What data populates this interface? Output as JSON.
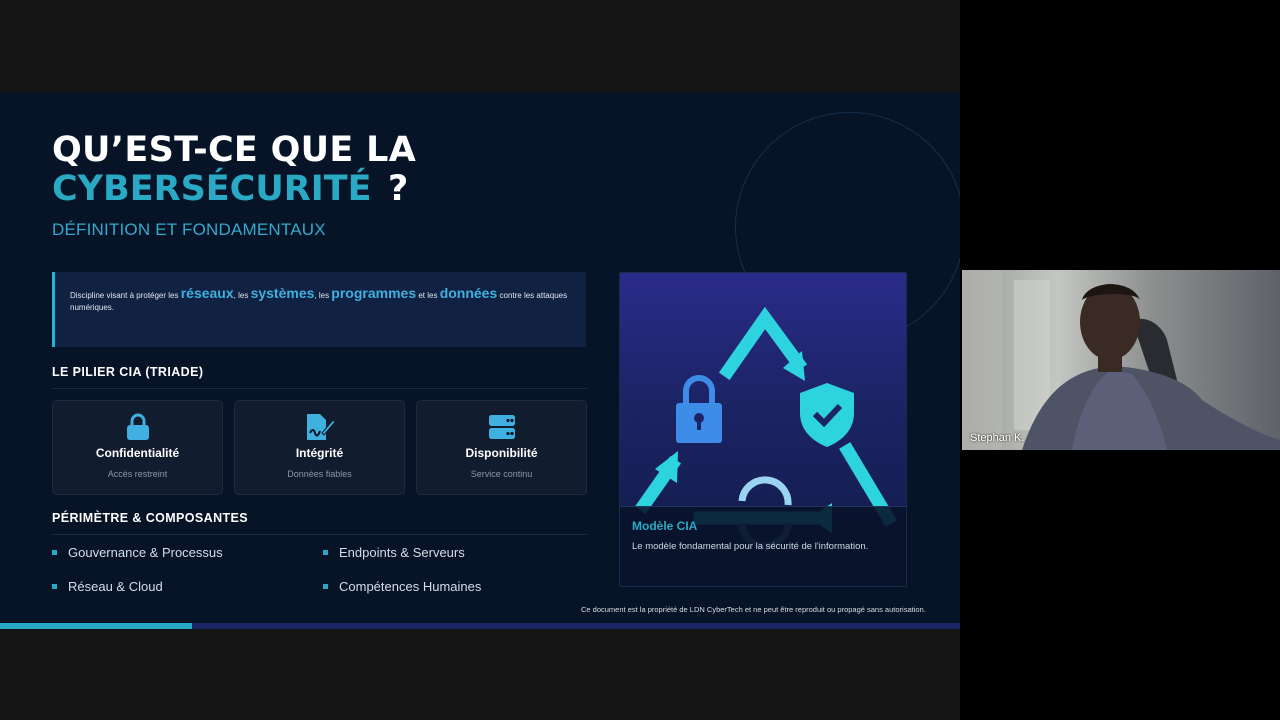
{
  "slide": {
    "title_line1": "QU’EST-CE QUE LA",
    "title_line2": "CYBERSÉCURITÉ",
    "title_q": "?",
    "subtitle": "DÉFINITION ET FONDAMENTAUX",
    "definition": {
      "p1": "Discipline visant à protéger les ",
      "k1": "réseaux",
      "p2": ", les ",
      "k2": "systèmes",
      "p3": ", les ",
      "k3": "programmes",
      "p4": " et les ",
      "k4": "données",
      "p5": " contre les attaques numériques."
    },
    "pillar_title": "LE PILIER CIA (TRIADE)",
    "cards": [
      {
        "title": "Confidentialité",
        "desc": "Accès restreint",
        "icon": "lock-icon"
      },
      {
        "title": "Intégrité",
        "desc": "Données fiables",
        "icon": "signed-document-icon"
      },
      {
        "title": "Disponibilité",
        "desc": "Service continu",
        "icon": "server-icon"
      }
    ],
    "scope_title": "PÉRIMÈTRE & COMPOSANTES",
    "bullets": [
      "Gouvernance & Processus",
      "Endpoints & Serveurs",
      "Réseau & Cloud",
      "Compétences Humaines"
    ],
    "cia_panel": {
      "caption_title": "Modèle CIA",
      "caption_text": "Le modèle fondamental pour la sécurité de l'information."
    },
    "notice": "Ce document est la propriété de LDN CyberTech et ne peut être reproduit ou propagé sans autorisation.",
    "progress": 0.2
  },
  "participant": {
    "name": "Stephan K."
  },
  "colors": {
    "accent": "#2aa9c4",
    "slide_bg": "#071326",
    "highlight": "#3fb0e0",
    "triangle": "#2ed3e0",
    "progress_track": "#1b2566"
  }
}
